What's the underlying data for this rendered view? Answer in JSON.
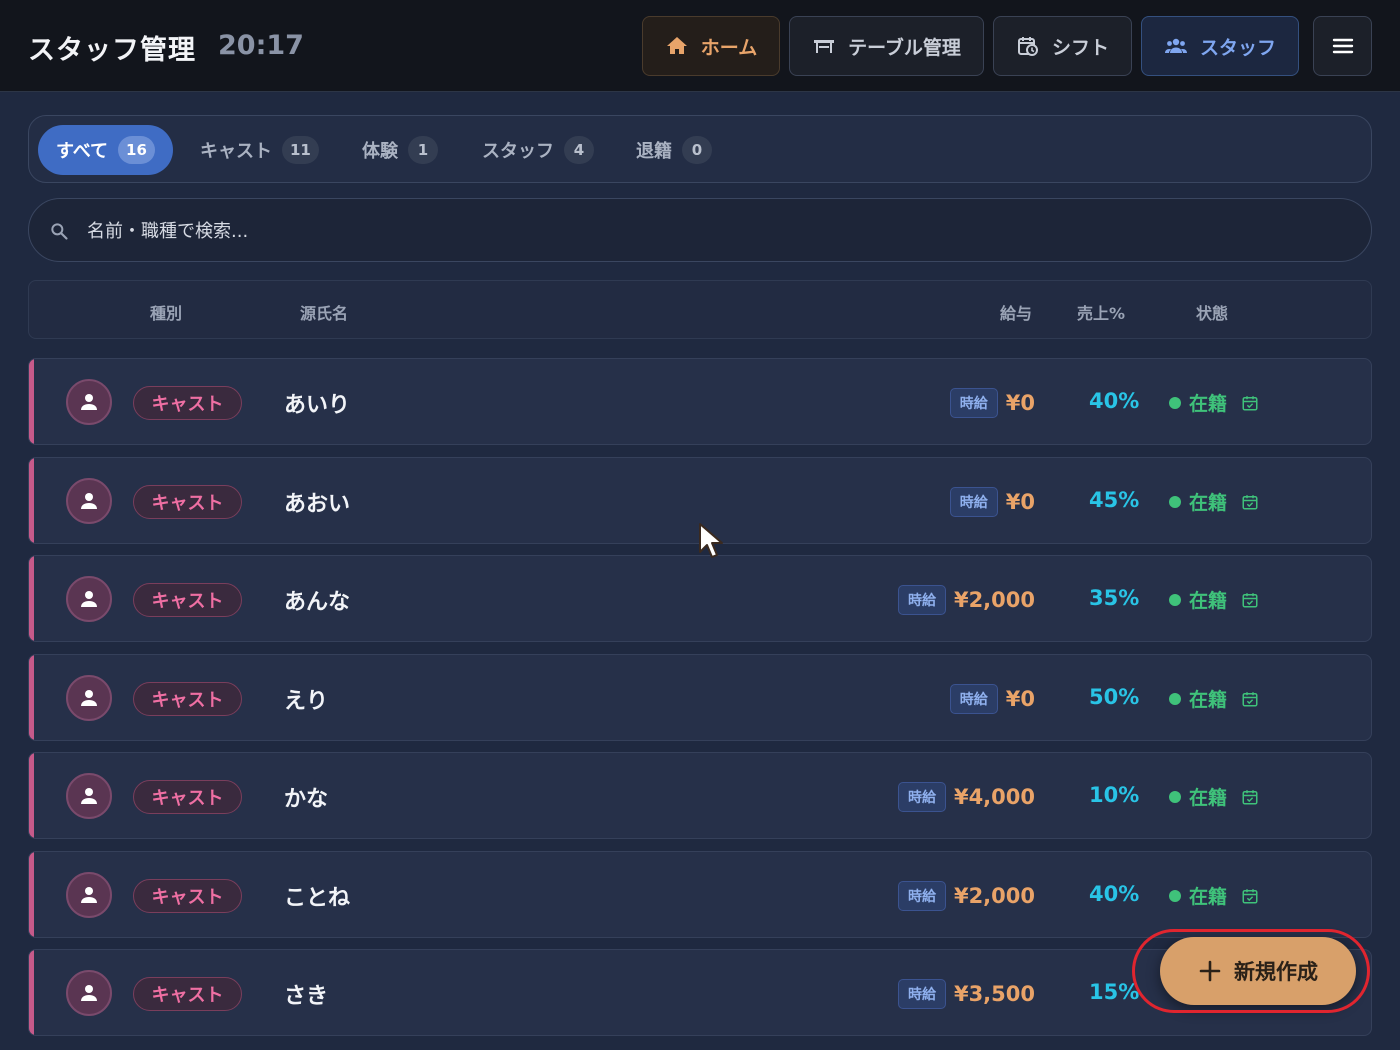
{
  "header": {
    "title": "スタッフ管理",
    "time": "20:17",
    "nav": [
      {
        "label": "ホーム",
        "icon": "home-icon"
      },
      {
        "label": "テーブル管理",
        "icon": "table-icon"
      },
      {
        "label": "シフト",
        "icon": "calendar-clock-icon"
      },
      {
        "label": "スタッフ",
        "icon": "people-icon"
      }
    ],
    "menu_icon": "hamburger-menu-icon"
  },
  "filters": [
    {
      "label": "すべて",
      "count": "16",
      "active": true
    },
    {
      "label": "キャスト",
      "count": "11",
      "active": false
    },
    {
      "label": "体験",
      "count": "1",
      "active": false
    },
    {
      "label": "スタッフ",
      "count": "4",
      "active": false
    },
    {
      "label": "退籍",
      "count": "0",
      "active": false
    }
  ],
  "search": {
    "placeholder": "名前・職種で検索..."
  },
  "columns": {
    "type": "種別",
    "name": "源氏名",
    "wage": "給与",
    "sales": "売上%",
    "status": "状態"
  },
  "rows": [
    {
      "type": "キャスト",
      "name": "あいり",
      "wage_type": "時給",
      "wage": "¥0",
      "pct": "40%",
      "status": "在籍"
    },
    {
      "type": "キャスト",
      "name": "あおい",
      "wage_type": "時給",
      "wage": "¥0",
      "pct": "45%",
      "status": "在籍"
    },
    {
      "type": "キャスト",
      "name": "あんな",
      "wage_type": "時給",
      "wage": "¥2,000",
      "pct": "35%",
      "status": "在籍"
    },
    {
      "type": "キャスト",
      "name": "えり",
      "wage_type": "時給",
      "wage": "¥0",
      "pct": "50%",
      "status": "在籍"
    },
    {
      "type": "キャスト",
      "name": "かな",
      "wage_type": "時給",
      "wage": "¥4,000",
      "pct": "10%",
      "status": "在籍"
    },
    {
      "type": "キャスト",
      "name": "ことね",
      "wage_type": "時給",
      "wage": "¥2,000",
      "pct": "40%",
      "status": "在籍"
    },
    {
      "type": "キャスト",
      "name": "さき",
      "wage_type": "時給",
      "wage": "¥3,500",
      "pct": "15%",
      "status": ""
    }
  ],
  "fab": {
    "label": "新規作成",
    "icon": "plus-icon"
  },
  "colors": {
    "accent_orange": "#d8a06a",
    "accent_blue": "#3f6cc4",
    "cast_pink": "#ef6fa3",
    "pct_cyan": "#29c4e6",
    "status_green": "#3fc27a",
    "highlight_red": "#e0252f"
  }
}
